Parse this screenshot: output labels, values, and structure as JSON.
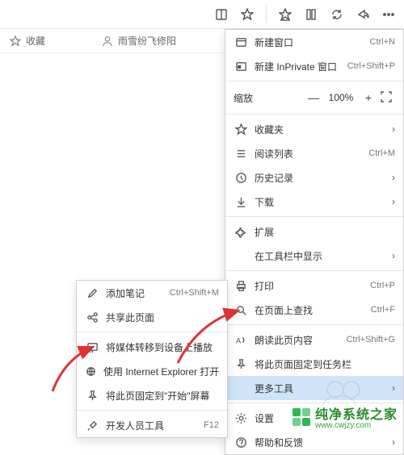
{
  "toolbar": {
    "icons": [
      "book-icon",
      "star-icon",
      "favorites-icon",
      "collections-icon",
      "sync-icon",
      "share-icon",
      "more-icon"
    ]
  },
  "bookmarks": {
    "fav_label": "收藏",
    "item1_label": "雨雪纷飞修阳"
  },
  "menu": {
    "new_window": "新建窗口",
    "new_window_sc": "Ctrl+N",
    "new_inprivate": "新建 InPrivate 窗口",
    "new_inprivate_sc": "Ctrl+Shift+P",
    "zoom_label": "缩放",
    "zoom_value": "100%",
    "favorites": "收藏夹",
    "reading_list": "阅读列表",
    "reading_list_sc": "Ctrl+M",
    "history": "历史记录",
    "downloads": "下载",
    "extensions": "扩展",
    "show_in_toolbar": "在工具栏中显示",
    "print": "打印",
    "print_sc": "Ctrl+P",
    "find": "在页面上查找",
    "find_sc": "Ctrl+F",
    "read_aloud": "朗读此页内容",
    "read_aloud_sc": "Ctrl+Shift+G",
    "pin_taskbar": "将此页面固定到任务栏",
    "more_tools": "更多工具",
    "settings": "设置",
    "help": "帮助和反馈"
  },
  "submenu": {
    "add_notes": "添加笔记",
    "add_notes_sc": "Ctrl+Shift+M",
    "share": "共享此页面",
    "cast": "将媒体转移到设备上播放",
    "open_ie": "使用 Internet Explorer 打开",
    "pin_start": "将此页固定到\"开始\"屏幕",
    "dev_tools": "开发人员工具",
    "dev_tools_sc": "F12"
  },
  "watermark": {
    "name": "纯净系统之家",
    "url": "www.cwjzy.com"
  }
}
